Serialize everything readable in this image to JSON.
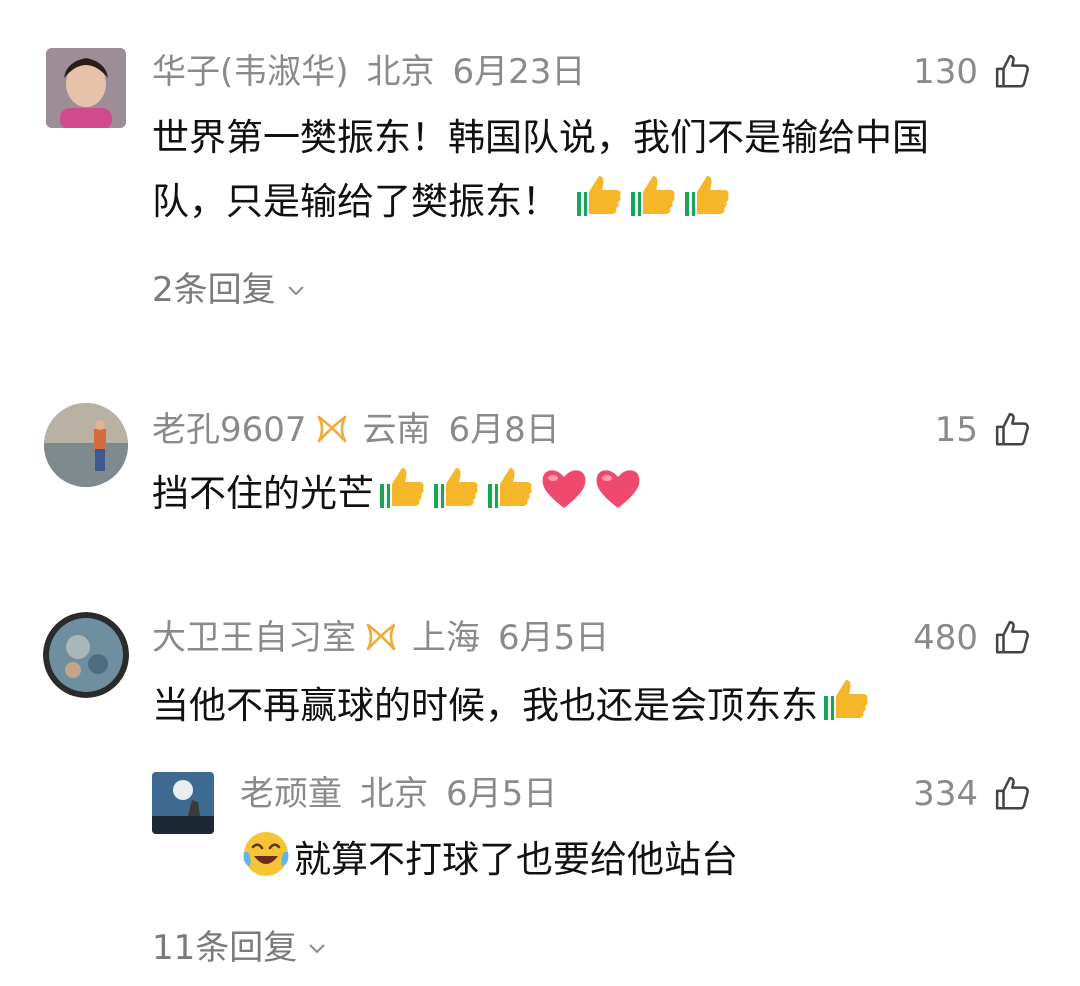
{
  "comments": [
    {
      "user": "华子(韦淑华)",
      "location": "北京",
      "date": "6月23日",
      "likes": "130",
      "text_line1": "世界第一樊振东！韩国队说，我们不是输给中国",
      "text_line2": "队，只是输给了樊振东！",
      "reply_count": "2条回复",
      "emoji_count": 3
    },
    {
      "user": "老孔9607",
      "location": "云南",
      "date": "6月8日",
      "likes": "15",
      "text": "挡不住的光芒",
      "emojis": [
        "thumbs-up",
        "thumbs-up",
        "thumbs-up",
        "heart",
        "heart"
      ]
    },
    {
      "user": "大卫王自习室",
      "location": "上海",
      "date": "6月5日",
      "likes": "480",
      "text": "当他不再赢球的时候，我也还是会顶东东",
      "reply": {
        "user": "老顽童",
        "location": "北京",
        "date": "6月5日",
        "likes": "334",
        "text": "就算不打球了也要给他站台"
      },
      "reply_count": "11条回复"
    }
  ],
  "icons": {
    "like": "thumbs-up-outline-icon",
    "vip": "vip-badge-icon",
    "expand": "chevron-down-icon"
  },
  "colors": {
    "meta": "#8a8a8a",
    "vip_badge": "#f0a93c",
    "text": "#111111"
  }
}
